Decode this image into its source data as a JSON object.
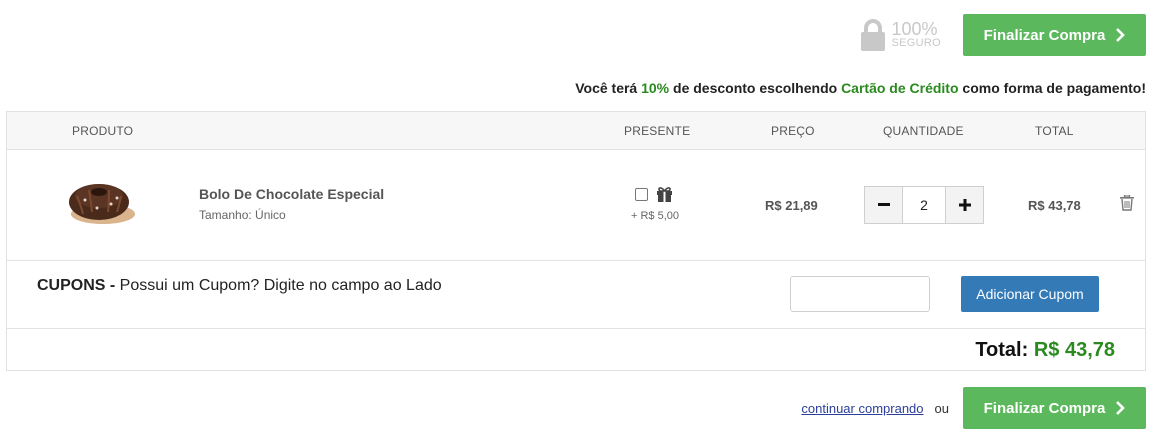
{
  "header": {
    "secure_percent": "100%",
    "secure_label": "SEGURO",
    "checkout_label": "Finalizar Compra"
  },
  "promo": {
    "part1": "Você terá ",
    "discount": "10%",
    "part2": " de desconto escolhendo ",
    "method": "Cartão de Crédito",
    "part3": " como forma de pagamento!"
  },
  "table": {
    "columns": {
      "produto": "PRODUTO",
      "presente": "PRESENTE",
      "preco": "PREÇO",
      "quantidade": "QUANTIDADE",
      "total": "TOTAL"
    }
  },
  "item": {
    "name": "Bolo De Chocolate Especial",
    "size": "Tamanho: Único",
    "gift_price": "+ R$ 5,00",
    "unit_price": "R$ 21,89",
    "quantity": "2",
    "total": "R$ 43,78",
    "gift_checked": false
  },
  "coupon": {
    "title": "CUPONS - ",
    "hint": "Possui um Cupom? Digite no campo ao Lado",
    "input_value": "",
    "button_label": "Adicionar Cupom"
  },
  "summary": {
    "total_label": "Total: ",
    "total_value": "R$ 43,78"
  },
  "footer": {
    "continue_label": "continuar comprando",
    "or_label": "ou",
    "checkout_label": "Finalizar Compra"
  },
  "colors": {
    "green_button": "#5cb85c",
    "blue_button": "#337ab7",
    "highlight_green": "#2a8a1f"
  }
}
